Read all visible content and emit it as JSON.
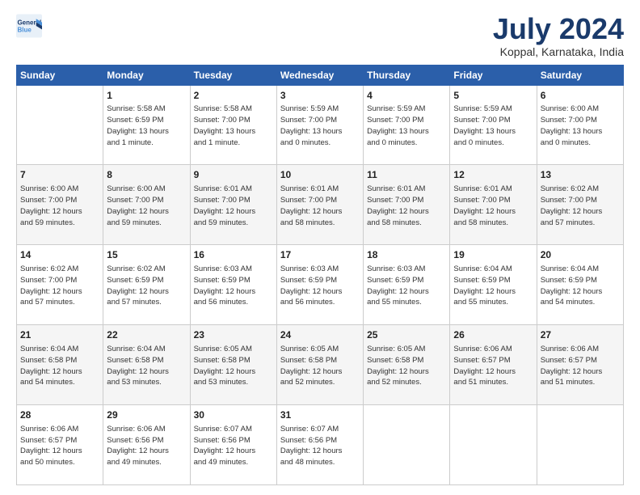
{
  "logo": {
    "line1": "General",
    "line2": "Blue"
  },
  "title": "July 2024",
  "subtitle": "Koppal, Karnataka, India",
  "columns": [
    "Sunday",
    "Monday",
    "Tuesday",
    "Wednesday",
    "Thursday",
    "Friday",
    "Saturday"
  ],
  "weeks": [
    [
      {
        "day": "",
        "text": ""
      },
      {
        "day": "1",
        "text": "Sunrise: 5:58 AM\nSunset: 6:59 PM\nDaylight: 13 hours\nand 1 minute."
      },
      {
        "day": "2",
        "text": "Sunrise: 5:58 AM\nSunset: 7:00 PM\nDaylight: 13 hours\nand 1 minute."
      },
      {
        "day": "3",
        "text": "Sunrise: 5:59 AM\nSunset: 7:00 PM\nDaylight: 13 hours\nand 0 minutes."
      },
      {
        "day": "4",
        "text": "Sunrise: 5:59 AM\nSunset: 7:00 PM\nDaylight: 13 hours\nand 0 minutes."
      },
      {
        "day": "5",
        "text": "Sunrise: 5:59 AM\nSunset: 7:00 PM\nDaylight: 13 hours\nand 0 minutes."
      },
      {
        "day": "6",
        "text": "Sunrise: 6:00 AM\nSunset: 7:00 PM\nDaylight: 13 hours\nand 0 minutes."
      }
    ],
    [
      {
        "day": "7",
        "text": "Sunrise: 6:00 AM\nSunset: 7:00 PM\nDaylight: 12 hours\nand 59 minutes."
      },
      {
        "day": "8",
        "text": "Sunrise: 6:00 AM\nSunset: 7:00 PM\nDaylight: 12 hours\nand 59 minutes."
      },
      {
        "day": "9",
        "text": "Sunrise: 6:01 AM\nSunset: 7:00 PM\nDaylight: 12 hours\nand 59 minutes."
      },
      {
        "day": "10",
        "text": "Sunrise: 6:01 AM\nSunset: 7:00 PM\nDaylight: 12 hours\nand 58 minutes."
      },
      {
        "day": "11",
        "text": "Sunrise: 6:01 AM\nSunset: 7:00 PM\nDaylight: 12 hours\nand 58 minutes."
      },
      {
        "day": "12",
        "text": "Sunrise: 6:01 AM\nSunset: 7:00 PM\nDaylight: 12 hours\nand 58 minutes."
      },
      {
        "day": "13",
        "text": "Sunrise: 6:02 AM\nSunset: 7:00 PM\nDaylight: 12 hours\nand 57 minutes."
      }
    ],
    [
      {
        "day": "14",
        "text": "Sunrise: 6:02 AM\nSunset: 7:00 PM\nDaylight: 12 hours\nand 57 minutes."
      },
      {
        "day": "15",
        "text": "Sunrise: 6:02 AM\nSunset: 6:59 PM\nDaylight: 12 hours\nand 57 minutes."
      },
      {
        "day": "16",
        "text": "Sunrise: 6:03 AM\nSunset: 6:59 PM\nDaylight: 12 hours\nand 56 minutes."
      },
      {
        "day": "17",
        "text": "Sunrise: 6:03 AM\nSunset: 6:59 PM\nDaylight: 12 hours\nand 56 minutes."
      },
      {
        "day": "18",
        "text": "Sunrise: 6:03 AM\nSunset: 6:59 PM\nDaylight: 12 hours\nand 55 minutes."
      },
      {
        "day": "19",
        "text": "Sunrise: 6:04 AM\nSunset: 6:59 PM\nDaylight: 12 hours\nand 55 minutes."
      },
      {
        "day": "20",
        "text": "Sunrise: 6:04 AM\nSunset: 6:59 PM\nDaylight: 12 hours\nand 54 minutes."
      }
    ],
    [
      {
        "day": "21",
        "text": "Sunrise: 6:04 AM\nSunset: 6:58 PM\nDaylight: 12 hours\nand 54 minutes."
      },
      {
        "day": "22",
        "text": "Sunrise: 6:04 AM\nSunset: 6:58 PM\nDaylight: 12 hours\nand 53 minutes."
      },
      {
        "day": "23",
        "text": "Sunrise: 6:05 AM\nSunset: 6:58 PM\nDaylight: 12 hours\nand 53 minutes."
      },
      {
        "day": "24",
        "text": "Sunrise: 6:05 AM\nSunset: 6:58 PM\nDaylight: 12 hours\nand 52 minutes."
      },
      {
        "day": "25",
        "text": "Sunrise: 6:05 AM\nSunset: 6:58 PM\nDaylight: 12 hours\nand 52 minutes."
      },
      {
        "day": "26",
        "text": "Sunrise: 6:06 AM\nSunset: 6:57 PM\nDaylight: 12 hours\nand 51 minutes."
      },
      {
        "day": "27",
        "text": "Sunrise: 6:06 AM\nSunset: 6:57 PM\nDaylight: 12 hours\nand 51 minutes."
      }
    ],
    [
      {
        "day": "28",
        "text": "Sunrise: 6:06 AM\nSunset: 6:57 PM\nDaylight: 12 hours\nand 50 minutes."
      },
      {
        "day": "29",
        "text": "Sunrise: 6:06 AM\nSunset: 6:56 PM\nDaylight: 12 hours\nand 49 minutes."
      },
      {
        "day": "30",
        "text": "Sunrise: 6:07 AM\nSunset: 6:56 PM\nDaylight: 12 hours\nand 49 minutes."
      },
      {
        "day": "31",
        "text": "Sunrise: 6:07 AM\nSunset: 6:56 PM\nDaylight: 12 hours\nand 48 minutes."
      },
      {
        "day": "",
        "text": ""
      },
      {
        "day": "",
        "text": ""
      },
      {
        "day": "",
        "text": ""
      }
    ]
  ]
}
